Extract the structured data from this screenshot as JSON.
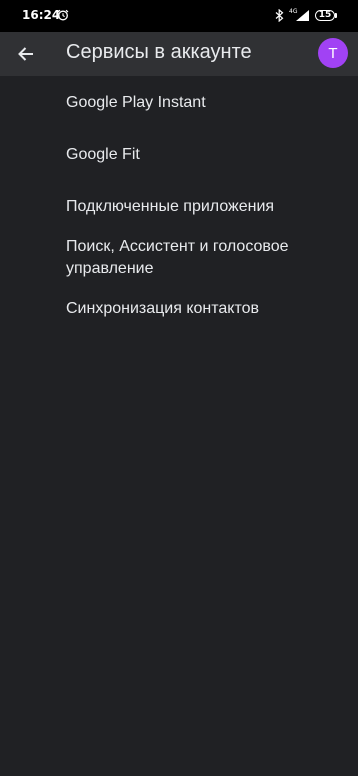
{
  "status_bar": {
    "time": "16:24",
    "network": "4G",
    "battery": "15",
    "icons": [
      "alarm-icon",
      "bluetooth-icon",
      "signal-icon",
      "battery-icon"
    ]
  },
  "app_bar": {
    "back_icon": "arrow-back-icon",
    "title": "Сервисы в аккаунте",
    "avatar_letter": "T",
    "avatar_color": "#a142f4"
  },
  "services": [
    {
      "label": "Google Play Instant"
    },
    {
      "label": "Google Fit"
    },
    {
      "label": "Подключенные приложения"
    },
    {
      "label": "Поиск, Ассистент и голосовое управление"
    },
    {
      "label": "Синхронизация контактов"
    }
  ],
  "colors": {
    "background": "#202124",
    "app_bar": "#303134",
    "text": "#e8eaed"
  }
}
